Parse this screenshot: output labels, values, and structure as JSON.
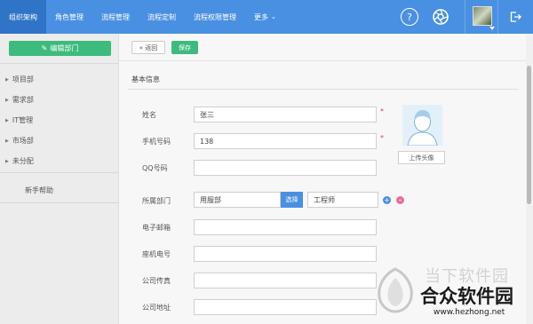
{
  "topnav": {
    "items": [
      {
        "label": "组织架构",
        "active": true
      },
      {
        "label": "角色管理"
      },
      {
        "label": "流程管理"
      },
      {
        "label": "流程定制"
      },
      {
        "label": "流程权限管理"
      },
      {
        "label": "更多",
        "has_dropdown": true
      }
    ],
    "help_glyph": "?"
  },
  "sidebar": {
    "edit_button_label": "编辑部门",
    "departments": [
      {
        "label": "项目部"
      },
      {
        "label": "需求部"
      },
      {
        "label": "IT管理"
      },
      {
        "label": "市场部"
      },
      {
        "label": "未分配"
      }
    ],
    "help_link": "新手帮助"
  },
  "toolbar": {
    "back_label": "« 返回",
    "save_label": "保存"
  },
  "form": {
    "section_title": "基本信息",
    "required_mark": "*",
    "name": {
      "label": "姓名",
      "value": "张三"
    },
    "phone": {
      "label": "手机号码",
      "value": "138"
    },
    "qq": {
      "label": "QQ号码",
      "value": ""
    },
    "department": {
      "label": "所属部门",
      "value": "用服部",
      "select_label": "选择",
      "position_value": "工程师"
    },
    "email": {
      "label": "电子邮箱",
      "value": ""
    },
    "landline": {
      "label": "座机电号",
      "value": ""
    },
    "fax": {
      "label": "公司传真",
      "value": ""
    },
    "address": {
      "label": "公司地址",
      "value": ""
    },
    "upload_label": "上传头像"
  },
  "watermark": {
    "top_text": "当下软件园",
    "main_text": "合众软件园",
    "url": "www.hezhong.net"
  },
  "icons": {
    "help": "help-icon",
    "settings": "settings-icon",
    "logout": "logout-icon",
    "edit": "edit-icon",
    "add": "plus-icon",
    "remove": "minus-icon"
  },
  "colors": {
    "topbar": "#4a90e2",
    "topbar_active": "#2f74c6",
    "green": "#3dbb7c",
    "required": "#e04444",
    "remove": "#e86ea0"
  }
}
